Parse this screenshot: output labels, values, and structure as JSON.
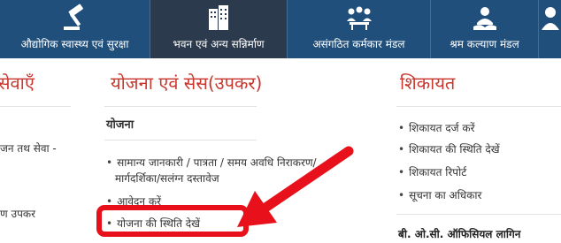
{
  "nav": {
    "tabs": [
      {
        "label": "औद्योगिक स्वास्थ्य एवं सुरक्षा",
        "icon": "gavel-icon",
        "active": false
      },
      {
        "label": "भवन एवं अन्य सन्निर्माण",
        "icon": "building-icon",
        "active": true
      },
      {
        "label": "असंगठित कर्मकार मंडल",
        "icon": "meeting-icon",
        "active": false
      },
      {
        "label": "श्रम कल्याण मंडल",
        "icon": "worker-icon",
        "active": false
      },
      {
        "label": "",
        "icon": "person-icon",
        "active": false
      }
    ]
  },
  "left": {
    "title": "सेवाएँ",
    "items": [
      "जन तथ सेवा -",
      "ण उपकर"
    ]
  },
  "center": {
    "title": "योजना एवं सेस(उपकर)",
    "subheading": "योजना",
    "items": [
      "सामान्य जानकारी / पात्रता / समय अवधि निराकरण/",
      "मार्गदर्शिका/सलंग्न दस्तावेज",
      "आवेदन करें",
      "योजना की स्थिति देखें"
    ]
  },
  "right": {
    "title": "शिकायत",
    "items": [
      "शिकायत दर्ज करें",
      "शिकायत की स्थिति देखें",
      "शिकायत रिपोर्ट",
      "सूचना का अधिकार"
    ],
    "footer": "बी. ओ.सी. ऑफिसियल लागिन"
  },
  "colors": {
    "nav_bg": "#1f4f7a",
    "nav_active": "#2b3a4c",
    "title_red": "#c8362e",
    "annotation_red": "#e8101a"
  }
}
